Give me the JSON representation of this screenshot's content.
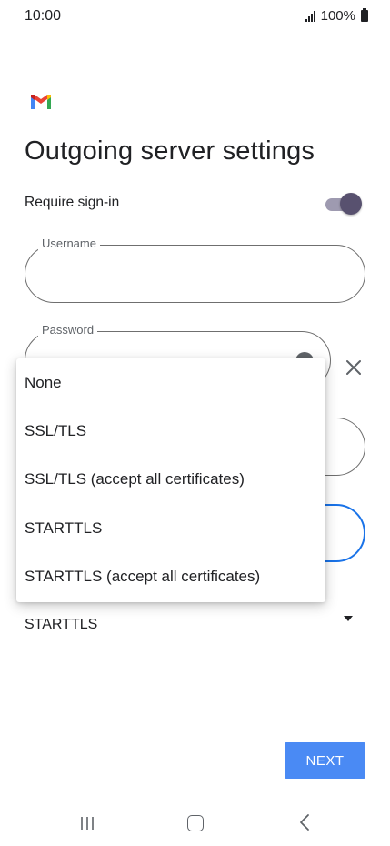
{
  "status_bar": {
    "time": "10:00",
    "battery": "100%"
  },
  "page": {
    "title": "Outgoing server settings"
  },
  "signin": {
    "label": "Require sign-in",
    "enabled": true
  },
  "fields": {
    "username": {
      "label": "Username",
      "value": ""
    },
    "password": {
      "label": "Password",
      "value": ""
    }
  },
  "security_type": {
    "selected": "STARTTLS",
    "options": [
      "None",
      "SSL/TLS",
      "SSL/TLS (accept all certificates)",
      "STARTTLS",
      "STARTTLS (accept all certificates)"
    ]
  },
  "actions": {
    "next_label": "NEXT"
  },
  "colors": {
    "accent": "#4a8af4",
    "focus_outline": "#1a73e8",
    "toggle_thumb": "#58516f",
    "toggle_track": "#9e9ab0"
  }
}
